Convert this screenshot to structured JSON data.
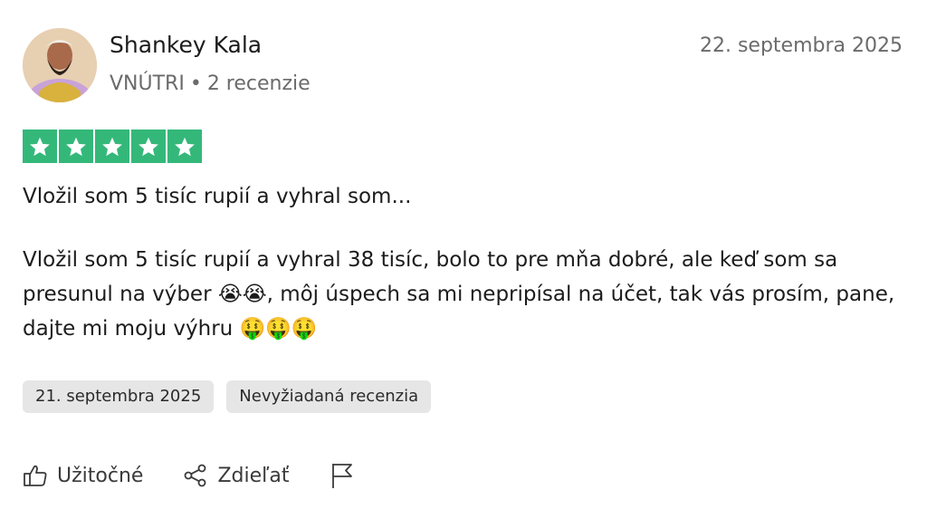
{
  "reviewer": {
    "name": "Shankey Kala",
    "country": "VNÚTRI",
    "separator": "•",
    "reviews_count": "2 recenzie"
  },
  "review": {
    "published_date": "22. septembra 2025",
    "rating": 5,
    "rating_max": 5,
    "star_color": "#34b87a",
    "title": "Vložil som 5 tisíc rupií a vyhral som...",
    "body": "Vložil som 5 tisíc rupií a vyhral 38 tisíc, bolo to pre mňa dobré, ale keď som sa presunul na výber 😭😭, môj úspech sa mi nepripísal na účet, tak vás prosím, pane, dajte mi moju výhru 🤑🤑🤑",
    "experience_date": "21. septembra 2025",
    "tag_label": "Nevyžiadaná recenzia"
  },
  "actions": {
    "useful_label": "Užitočné",
    "share_label": "Zdieľať",
    "useful_icon": "thumbs-up-icon",
    "share_icon": "share-icon",
    "report_icon": "flag-icon"
  }
}
